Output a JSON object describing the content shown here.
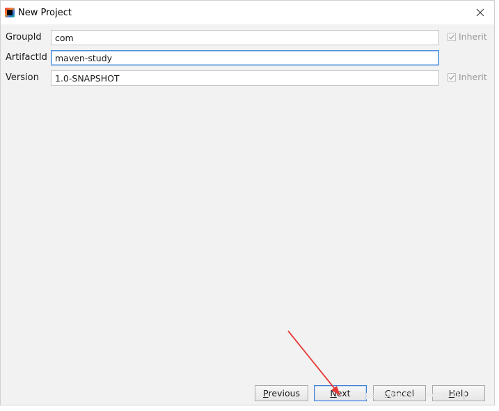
{
  "window": {
    "title": "New Project",
    "icon": "intellij-app-icon",
    "close_icon": "close-icon"
  },
  "form": {
    "group_id": {
      "label": "GroupId",
      "value": "com",
      "inherit_label": "Inherit",
      "inherit_checked": true
    },
    "artifact_id": {
      "label": "ArtifactId",
      "value": "maven-study"
    },
    "version": {
      "label": "Version",
      "value": "1.0-SNAPSHOT",
      "inherit_label": "Inherit",
      "inherit_checked": true
    }
  },
  "buttons": {
    "previous": {
      "mnemonic": "P",
      "rest": "revious"
    },
    "next": {
      "mnemonic": "N",
      "rest": "ext"
    },
    "cancel": {
      "mnemonic": "C",
      "rest": "ancel"
    },
    "help": {
      "mnemonic": "H",
      "rest": "elp"
    }
  },
  "annotation": {
    "arrow_color": "#e53935"
  },
  "watermark": "https://blog.csdn.net/h_Q_L"
}
